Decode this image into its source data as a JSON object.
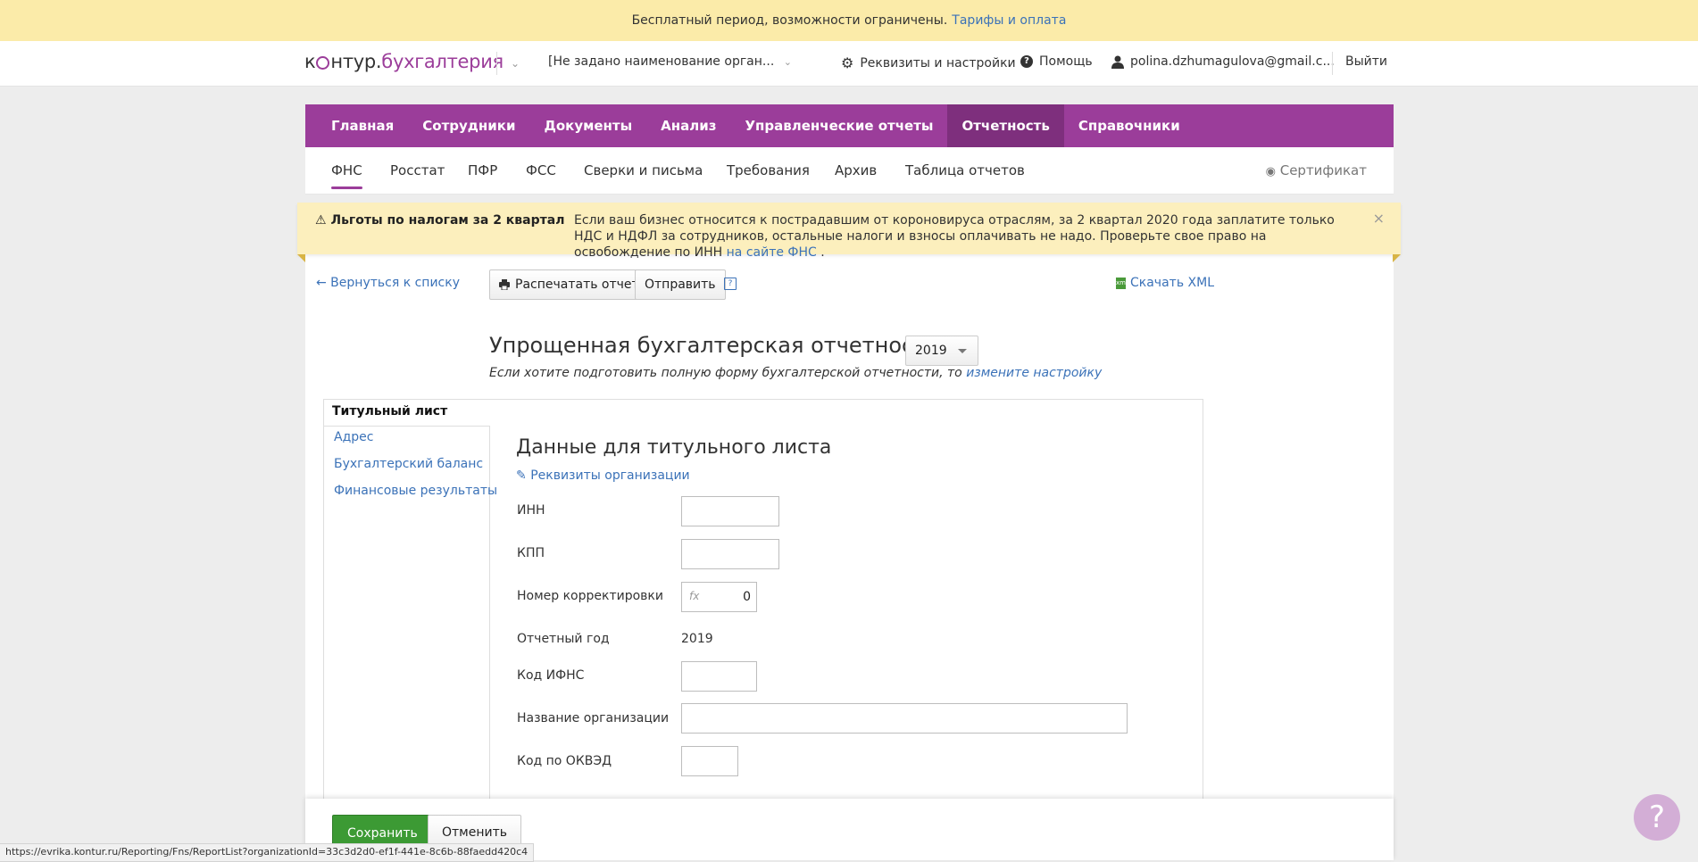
{
  "promo": {
    "text": "Бесплатный период, возможности ограничены.",
    "link": "Тарифы и оплата"
  },
  "header": {
    "logo_left": "к",
    "logo_mid": "нтур.",
    "logo_right": "бухгалтерия",
    "org": "[Не задано наименование орган...",
    "settings": "Реквизиты и настройки",
    "help": "Помощь",
    "user": "polina.dzhumagulova@gmail.c...",
    "logout": "Выйти"
  },
  "mainnav": [
    "Главная",
    "Сотрудники",
    "Документы",
    "Анализ",
    "Управленческие отчеты",
    "Отчетность",
    "Справочники"
  ],
  "subnav": [
    "ФНС",
    "Росстат",
    "ПФР",
    "ФСС",
    "Сверки и письма",
    "Требования",
    "Архив",
    "Таблица отчетов"
  ],
  "certificate": "Сертификат",
  "banner": {
    "title": "Льготы по налогам за 2 квартал",
    "text": "Если ваш бизнес относится к пострадавшим от короновируса отраслям, за 2 квартал 2020 года заплатите только НДС и НДФЛ за сотрудников, остальные налоги и взносы оплачивать не надо. Проверьте свое право на освобождение по ИНН",
    "link": "на сайте ФНС",
    "tail": "."
  },
  "toolbar": {
    "back": "← Вернуться к списку",
    "print": "Распечатать отчет",
    "send": "Отправить",
    "help": "?",
    "xml": "Скачать XML"
  },
  "form": {
    "title": "Упрощенная бухгалтерская отчетность за",
    "year": "2019",
    "hint": "Если хотите подготовить полную форму бухгалтерской отчетности, то",
    "hint_link": "измените настройку"
  },
  "sidebar": {
    "active": "Титульный лист",
    "items": [
      "Адрес",
      "Бухгалтерский баланс",
      "Финансовые результаты"
    ]
  },
  "section": {
    "title": "Данные для титульного листа",
    "requisites": "Реквизиты организации",
    "fields": {
      "inn": "ИНН",
      "kpp": "КПП",
      "correction": "Номер корректировки",
      "correction_value": "0",
      "fx": "fx",
      "year_label": "Отчетный год",
      "year_value": "2019",
      "ifns": "Код ИФНС",
      "org_name": "Название организации",
      "okved": "Код по ОКВЭД"
    }
  },
  "actions": {
    "save": "Сохранить",
    "cancel": "Отменить"
  },
  "status_url": "https://evrika.kontur.ru/Reporting/Fns/ReportList?organizationId=33c3d2d0-ef1f-441e-8c6b-88faedd420c4",
  "support": "?",
  "colors": {
    "brand": "#9b3d9a",
    "promo_bg": "#fbeba9",
    "banner_bg": "#fcefbd",
    "save": "#3c9a34",
    "link": "#3b72b8"
  }
}
